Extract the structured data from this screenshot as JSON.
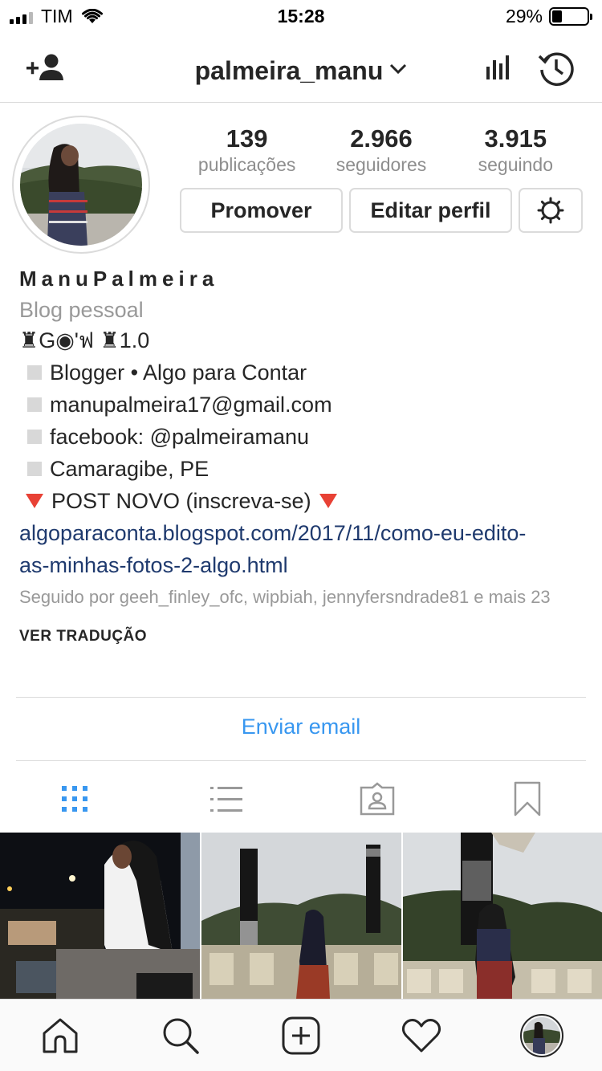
{
  "status_bar": {
    "carrier": "TIM",
    "time": "15:28",
    "battery": "29%",
    "battery_level": 0.29
  },
  "header": {
    "username": "palmeira_manu",
    "icons": [
      "add-user-icon",
      "chevron-down-icon",
      "insights-icon",
      "history-icon"
    ]
  },
  "stats": [
    {
      "value": "139",
      "label": "publicações"
    },
    {
      "value": "2.966",
      "label": "seguidores"
    },
    {
      "value": "3.915",
      "label": "seguindo"
    }
  ],
  "buttons": {
    "promote": "Promover",
    "edit_profile": "Editar perfil"
  },
  "bio": {
    "name": "ManuPalmeira",
    "category": "Blog pessoal",
    "line1": "♜G◉'ฟ ♜1.0",
    "line2": "Blogger • Algo para Contar",
    "line3": "manupalmeira17@gmail.com",
    "line4": "facebook: @palmeiramanu",
    "line5": "Camaragibe, PE",
    "line6": "POST NOVO (inscreva-se)",
    "link_line1": "algoparaconta.blogspot.com/2017/11/como-eu-edito-",
    "link_line2": "as-minhas-fotos-2-algo.html",
    "followed_by": "Seguido por geeh_finley_ofc, wipbiah, jennyfersndrade81 e mais 23",
    "translate": "VER TRADUÇÃO"
  },
  "email_button": "Enviar email",
  "tabs": [
    "grid-icon",
    "list-icon",
    "tagged-icon",
    "saved-icon"
  ],
  "colors": {
    "link": "#3897f0",
    "bio_link": "#1f3a6e",
    "accent_triangle": "#e84135",
    "muted": "#8e8e8e"
  },
  "bottom_nav": [
    "home-icon",
    "search-icon",
    "new-post-icon",
    "activity-icon",
    "profile-avatar"
  ]
}
